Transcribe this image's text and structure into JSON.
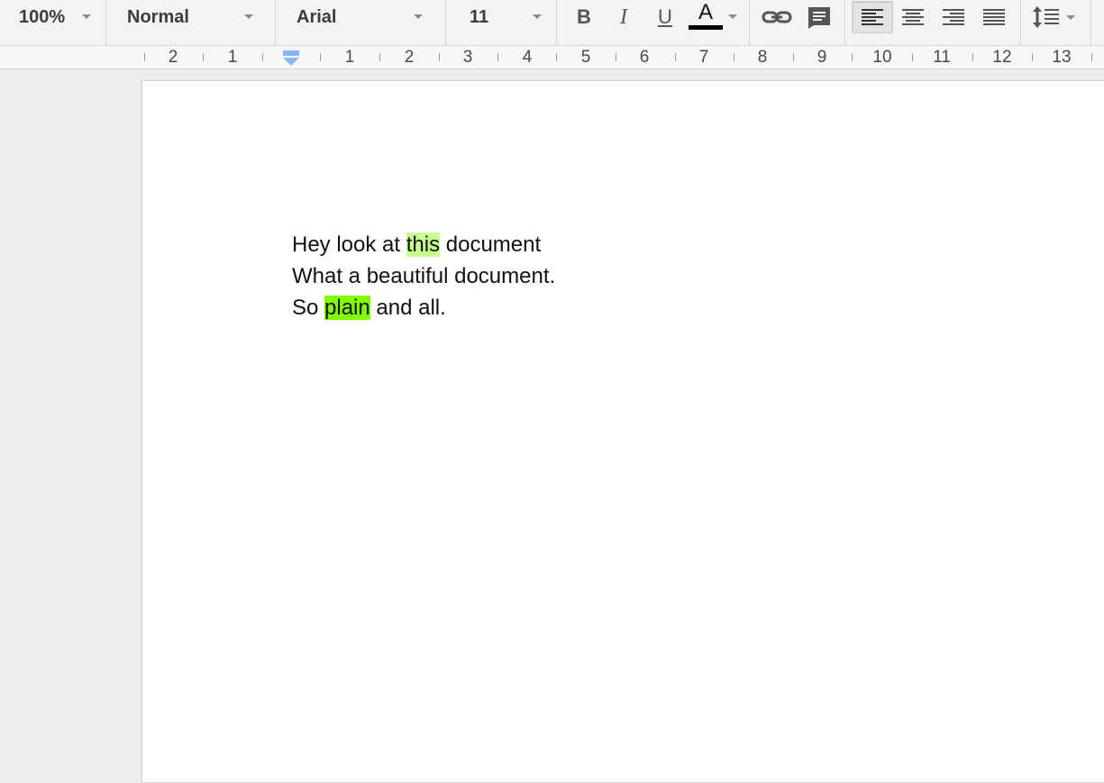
{
  "toolbar": {
    "zoom": "100%",
    "style": "Normal",
    "font": "Arial",
    "size": "11",
    "bold_label": "B",
    "italic_label": "I",
    "underline_label": "U",
    "text_color_label": "A",
    "text_color": "#000000",
    "icons": [
      "link-icon",
      "comment-icon",
      "align-left-icon",
      "align-center-icon",
      "align-right-icon",
      "align-justify-icon",
      "line-spacing-icon"
    ]
  },
  "ruler": {
    "labels": [
      "2",
      "1",
      "1",
      "2",
      "3",
      "4",
      "5",
      "6",
      "7",
      "8",
      "9",
      "10",
      "11",
      "12",
      "13"
    ]
  },
  "document": {
    "line1": {
      "before": "Hey look at ",
      "highlight": "this",
      "after": " document"
    },
    "line2": "What a beautiful document.",
    "line3": {
      "before": "So ",
      "highlight": "plain",
      "after": " and all."
    },
    "highlight_colors": [
      "#c6ff8f",
      "#7fff00"
    ]
  }
}
